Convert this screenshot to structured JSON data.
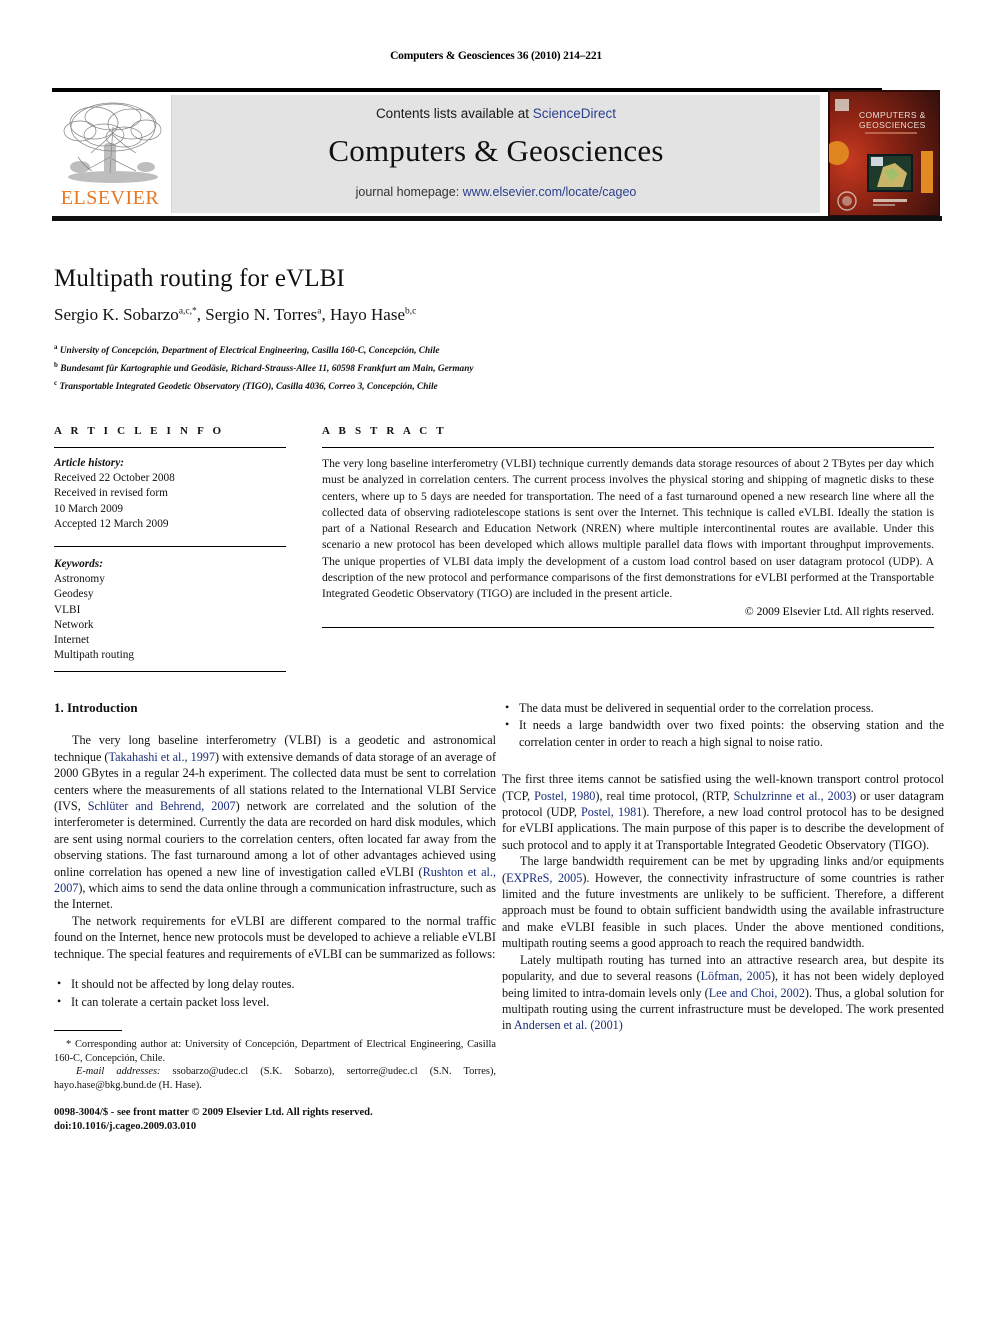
{
  "running_head": "Computers & Geosciences 36 (2010) 214–221",
  "masthead": {
    "contents_prefix": "Contents lists available at ",
    "sciencedirect": "ScienceDirect",
    "journal_name": "Computers & Geosciences",
    "homepage_prefix": "journal homepage: ",
    "homepage_url": "www.elsevier.com/locate/cageo",
    "publisher": "ELSEVIER",
    "cover_title_line1": "COMPUTERS &",
    "cover_title_line2": "GEOSCIENCES",
    "accent_orange": "#E87722",
    "link_blue": "#2b3f8c",
    "band_gray": "#e3e3e3"
  },
  "article": {
    "title": "Multipath routing for eVLBI",
    "authors": "Sergio K. Sobarzo",
    "authors_sup_1": "a,c,",
    "authors_star": "*",
    "authors_2": ", Sergio N. Torres",
    "authors_sup_2": "a",
    "authors_3": ", Hayo Hase",
    "authors_sup_3": "b,c",
    "affiliations": [
      {
        "mark": "a",
        "text": "University of Concepción, Department of Electrical Engineering, Casilla 160-C, Concepción, Chile"
      },
      {
        "mark": "b",
        "text": "Bundesamt für Kartographie und Geodäsie, Richard-Strauss-Allee 11, 60598 Frankfurt am Main, Germany"
      },
      {
        "mark": "c",
        "text": "Transportable Integrated Geodetic Observatory (TIGO), Casilla 4036, Correo 3, Concepción, Chile"
      }
    ]
  },
  "article_info": {
    "heading": "A R T I C L E   I N F O",
    "history_label": "Article history:",
    "history_lines": [
      "Received 22 October 2008",
      "Received in revised form",
      "10 March 2009",
      "Accepted 12 March 2009"
    ],
    "keywords_label": "Keywords:",
    "keywords": [
      "Astronomy",
      "Geodesy",
      "VLBI",
      "Network",
      "Internet",
      "Multipath routing"
    ]
  },
  "abstract": {
    "heading": "A B S T R A C T",
    "text": "The very long baseline interferometry (VLBI) technique currently demands data storage resources of about 2 TBytes per day which must be analyzed in correlation centers. The current process involves the physical storing and shipping of magnetic disks to these centers, where up to 5 days are needed for transportation. The need of a fast turnaround opened a new research line where all the collected data of observing radiotelescope stations is sent over the Internet. This technique is called eVLBI. Ideally the station is part of a National Research and Education Network (NREN) where multiple intercontinental routes are available. Under this scenario a new protocol has been developed which allows multiple parallel data flows with important throughput improvements. The unique properties of VLBI data imply the development of a custom load control based on user datagram protocol (UDP). A description of the new protocol and performance comparisons of the first demonstrations for eVLBI performed at the Transportable Integrated Geodetic Observatory (TIGO) are included in the present article.",
    "copyright": "© 2009 Elsevier Ltd. All rights reserved."
  },
  "body": {
    "section_heading": "1. Introduction",
    "left": {
      "para1_a": "The very long baseline interferometry (VLBI) is a geodetic and astronomical technique (",
      "para1_ref1": "Takahashi et al., 1997",
      "para1_b": ") with extensive demands of data storage of an average of 2000 GBytes in a regular 24-h experiment. The collected data must be sent to correlation centers where the measurements of all stations related to the International VLBI Service (IVS, ",
      "para1_ref2": "Schlüter and Behrend, 2007",
      "para1_c": ") network are correlated and the solution of the interferometer is determined. Currently the data are recorded on hard disk modules, which are sent using normal couriers to the correlation centers, often located far away from the observing stations. The fast turnaround among a lot of other advantages achieved using online correlation has opened a new line of investigation called eVLBI (",
      "para1_ref3": "Rushton et al., 2007",
      "para1_d": "), which aims to send the data online through a communication infrastructure, such as the Internet.",
      "para2": "The network requirements for eVLBI are different compared to the normal traffic found on the Internet, hence new protocols must be developed to achieve a reliable eVLBI technique. The special features and requirements of eVLBI can be summarized as follows:",
      "bullets": [
        "It should not be affected by long delay routes.",
        "It can tolerate a certain packet loss level."
      ],
      "footnote_star": "*",
      "footnote_corresponding": " Corresponding author at: University of Concepción, Department of Electrical Engineering, Casilla 160-C, Concepción, Chile.",
      "footnote_email_label": "E-mail addresses:",
      "footnote_emails": " ssobarzo@udec.cl (S.K. Sobarzo), sertorre@udec.cl (S.N. Torres), hayo.hase@bkg.bund.de (H. Hase).",
      "issn_line": "0098-3004/$ - see front matter © 2009 Elsevier Ltd. All rights reserved.",
      "doi_line": "doi:10.1016/j.cageo.2009.03.010"
    },
    "right": {
      "bullets": [
        "The data must be delivered in sequential order to the correlation process.",
        "It needs a large bandwidth over two fixed points: the observing station and the correlation center in order to reach a high signal to noise ratio."
      ],
      "para1_a": "The first three items cannot be satisfied using the well-known transport control protocol (TCP, ",
      "para1_ref1": "Postel, 1980",
      "para1_b": "), real time protocol, (RTP, ",
      "para1_ref2": "Schulzrinne et al., 2003",
      "para1_c": ") or user datagram protocol (UDP, ",
      "para1_ref3": "Postel, 1981",
      "para1_d": "). Therefore, a new load control protocol has to be designed for eVLBI applications. The main purpose of this paper is to describe the development of such protocol and to apply it at Transportable Integrated Geodetic Observatory (TIGO).",
      "para2_a": "The large bandwidth requirement can be met by upgrading links and/or equipments (",
      "para2_ref1": "EXPReS, 2005",
      "para2_b": "). However, the connectivity infrastructure of some countries is rather limited and the future investments are unlikely to be sufficient. Therefore, a different approach must be found to obtain sufficient bandwidth using the available infrastructure and make eVLBI feasible in such places. Under the above mentioned conditions, multipath routing seems a good approach to reach the required bandwidth.",
      "para3_a": "Lately multipath routing has turned into an attractive research area, but despite its popularity, and due to several reasons (",
      "para3_ref1": "Löfman, 2005",
      "para3_b": "), it has not been widely deployed being limited to intra-domain levels only (",
      "para3_ref2": "Lee and Choi, 2002",
      "para3_c": "). Thus, a global solution for multipath routing using the current infrastructure must be developed. The work presented in ",
      "para3_ref3": "Andersen et al. (2001)"
    }
  }
}
